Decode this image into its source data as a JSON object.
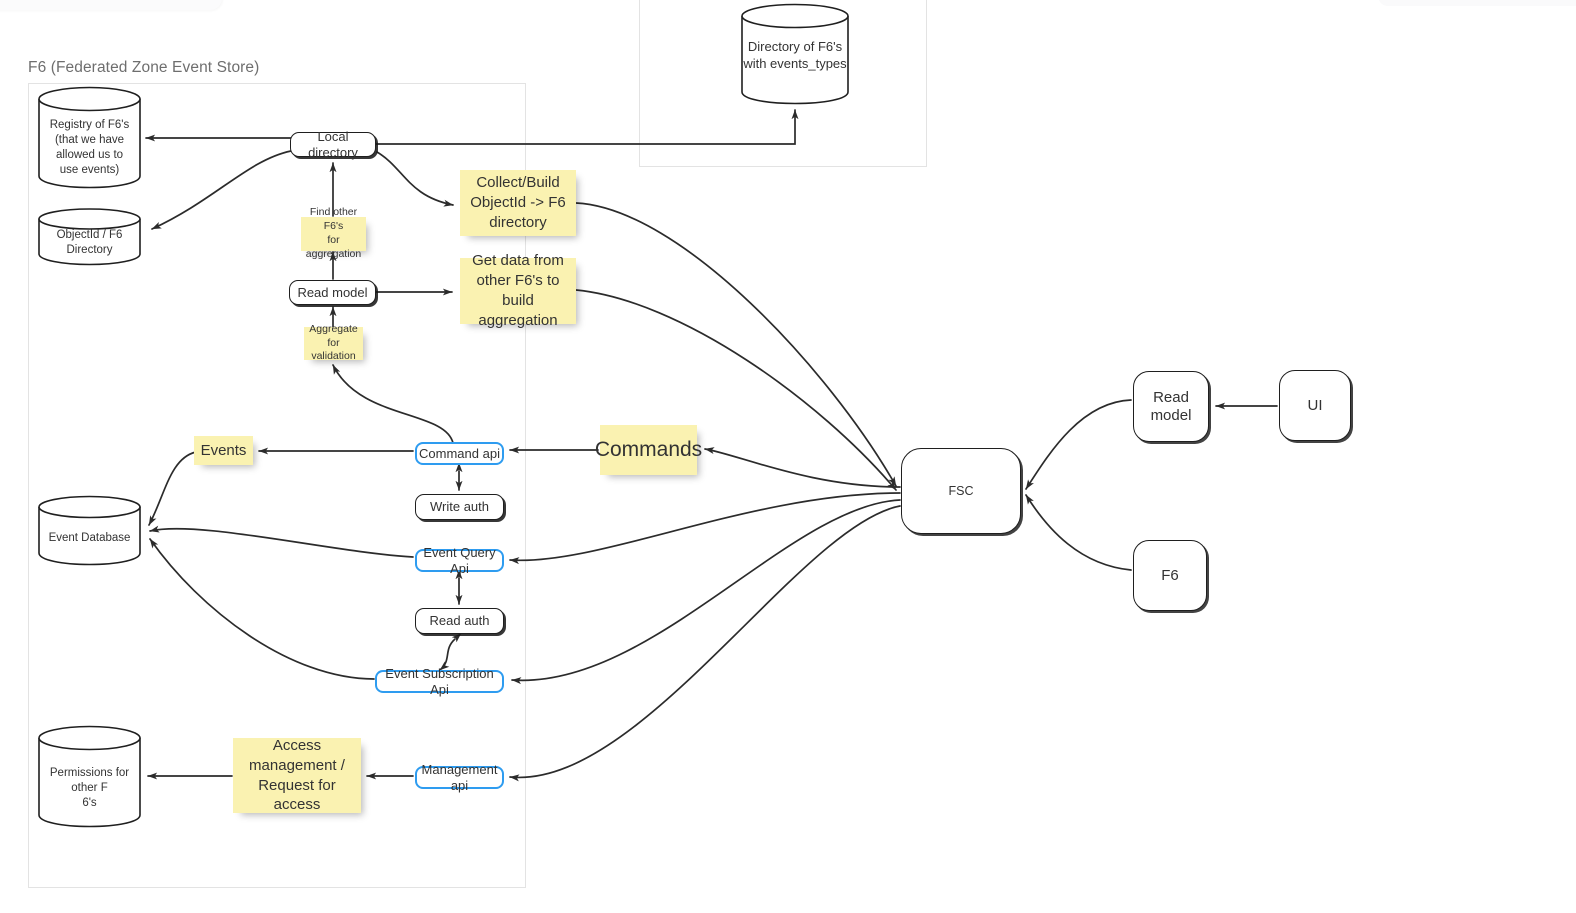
{
  "diagram": {
    "title": "F6 (Federated Zone Event Store)",
    "type": "architecture-diagram"
  },
  "frames": [
    {
      "name": "f6-zone-frame",
      "title": "F6 (Federated Zone Event Store)"
    },
    {
      "name": "directory-frame",
      "title": ""
    }
  ],
  "datastores": [
    {
      "id": "registry-of-f6s",
      "label": "Registry of F6's\n(that we have\nallowed us to\nuse events)",
      "lines": [
        "Registry of F6's",
        "(that we have",
        "allowed us to",
        "use events)"
      ]
    },
    {
      "id": "objectid-f6-directory",
      "label": "ObjectId / F6\nDirectory",
      "lines": [
        "ObjectId / F6",
        "Directory"
      ]
    },
    {
      "id": "event-database",
      "label": "Event Database",
      "lines": [
        "Event Database"
      ]
    },
    {
      "id": "permissions-for-other-f6s",
      "label": "Permissions for\nother F\n6's",
      "lines": [
        "Permissions for",
        "other F",
        "6's"
      ]
    },
    {
      "id": "directory-of-f6s-with-event-types",
      "label": "Directory of F6's\nwith events_types",
      "lines": [
        "Directory of F6's",
        "with events_types"
      ]
    }
  ],
  "nodes": [
    {
      "id": "local-directory",
      "label": "Local directory",
      "style": "rounded"
    },
    {
      "id": "read-model-left",
      "label": "Read model",
      "style": "rounded"
    },
    {
      "id": "command-api",
      "label": "Command api",
      "style": "api"
    },
    {
      "id": "write-auth",
      "label": "Write auth",
      "style": "rounded"
    },
    {
      "id": "event-query-api",
      "label": "Event Query Api",
      "style": "api"
    },
    {
      "id": "read-auth",
      "label": "Read auth",
      "style": "rounded"
    },
    {
      "id": "event-subscription-api",
      "label": "Event Subscription Api",
      "style": "api"
    },
    {
      "id": "management-api",
      "label": "Management api",
      "style": "api"
    },
    {
      "id": "fsc",
      "label": "FSC",
      "style": "fsc"
    },
    {
      "id": "read-model-right",
      "label": "Read model",
      "style": "big",
      "lines": [
        "Read",
        "model"
      ]
    },
    {
      "id": "ui",
      "label": "UI",
      "style": "big"
    },
    {
      "id": "f6",
      "label": "F6",
      "style": "big"
    }
  ],
  "stickies": [
    {
      "id": "find-other-f6s",
      "label": "Find other F6's\nfor aggregation",
      "lines": [
        "Find other F6's",
        "for aggregation"
      ],
      "size": "sm"
    },
    {
      "id": "aggregate-for-validation",
      "label": "Aggregate for\nvalidation",
      "lines": [
        "Aggregate for",
        "validation"
      ],
      "size": "sm"
    },
    {
      "id": "collect-build-objectid",
      "label": "Collect/Build ObjectId -> F6 directory",
      "lines": [
        "Collect/Build",
        "ObjectId -> F6",
        "directory"
      ],
      "size": "md"
    },
    {
      "id": "get-data-from-other-f6s",
      "label": "Get data from other F6's to build aggregation",
      "lines": [
        "Get data from",
        "other F6's to build",
        "aggregation"
      ],
      "size": "md"
    },
    {
      "id": "events",
      "label": "Events",
      "lines": [
        "Events"
      ],
      "size": "md"
    },
    {
      "id": "commands",
      "label": "Commands",
      "lines": [
        "Commands"
      ],
      "size": "lg"
    },
    {
      "id": "access-management",
      "label": "Access management / Request for access",
      "lines": [
        "Access",
        "management /",
        "Request for access"
      ],
      "size": "md"
    }
  ],
  "colors": {
    "sticky": "#faf2b1",
    "api_border": "#2e9cf0",
    "node_border": "#1f1f1f",
    "text": "#333333",
    "frame_border": "#e3e3e3",
    "title_text": "#6e6e6e",
    "connector": "#2b2b2b"
  },
  "connections": [
    {
      "from": "local-directory",
      "to": "registry-of-f6s",
      "direction": "one-way"
    },
    {
      "from": "local-directory",
      "to": "objectid-f6-directory",
      "direction": "one-way"
    },
    {
      "from": "local-directory",
      "to": "directory-of-f6s-with-event-types",
      "direction": "one-way"
    },
    {
      "from": "local-directory",
      "to": "collect-build-objectid",
      "direction": "one-way"
    },
    {
      "from": "find-other-f6s",
      "to": "local-directory",
      "direction": "one-way"
    },
    {
      "from": "read-model-left",
      "to": "find-other-f6s",
      "direction": "one-way"
    },
    {
      "from": "read-model-left",
      "to": "get-data-from-other-f6s",
      "direction": "one-way"
    },
    {
      "from": "aggregate-for-validation",
      "to": "read-model-left",
      "direction": "one-way"
    },
    {
      "from": "command-api",
      "to": "aggregate-for-validation",
      "direction": "one-way"
    },
    {
      "from": "command-api",
      "to": "events",
      "direction": "one-way"
    },
    {
      "from": "events",
      "to": "event-database",
      "direction": "one-way"
    },
    {
      "from": "command-api",
      "to": "write-auth",
      "direction": "two-way"
    },
    {
      "from": "commands",
      "to": "command-api",
      "direction": "one-way"
    },
    {
      "from": "fsc",
      "to": "commands",
      "direction": "one-way"
    },
    {
      "from": "event-query-api",
      "to": "event-database",
      "direction": "one-way"
    },
    {
      "from": "event-query-api",
      "to": "read-auth",
      "direction": "two-way"
    },
    {
      "from": "read-auth",
      "to": "event-subscription-api",
      "direction": "two-way"
    },
    {
      "from": "event-subscription-api",
      "to": "event-database",
      "direction": "one-way"
    },
    {
      "from": "fsc",
      "to": "event-query-api",
      "direction": "one-way"
    },
    {
      "from": "fsc",
      "to": "event-subscription-api",
      "direction": "one-way"
    },
    {
      "from": "fsc",
      "to": "management-api",
      "direction": "one-way"
    },
    {
      "from": "management-api",
      "to": "access-management",
      "direction": "one-way"
    },
    {
      "from": "access-management",
      "to": "permissions-for-other-f6s",
      "direction": "one-way"
    },
    {
      "from": "collect-build-objectid",
      "to": "fsc",
      "direction": "one-way"
    },
    {
      "from": "get-data-from-other-f6s",
      "to": "fsc",
      "direction": "one-way"
    },
    {
      "from": "read-model-right",
      "to": "fsc",
      "direction": "one-way"
    },
    {
      "from": "f6",
      "to": "fsc",
      "direction": "one-way"
    },
    {
      "from": "ui",
      "to": "read-model-right",
      "direction": "one-way"
    }
  ]
}
